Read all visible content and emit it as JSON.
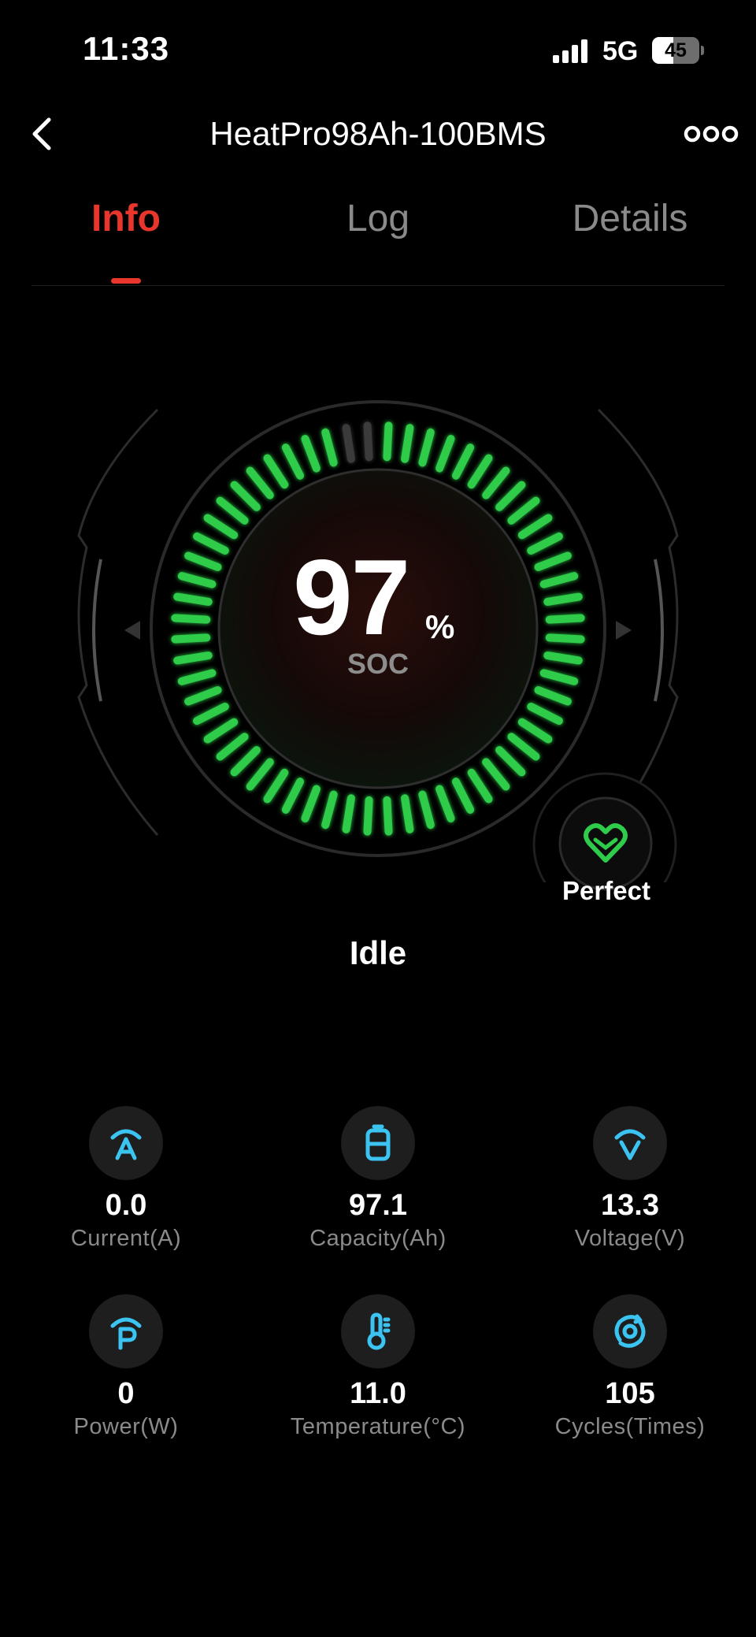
{
  "status_bar": {
    "time": "11:33",
    "network": "5G",
    "battery_percent": "45",
    "battery_level": 0.45
  },
  "nav": {
    "back_icon": "chevron-left-icon",
    "title": "HeatPro98Ah-100BMS",
    "more_icon": "more-dots-icon"
  },
  "tabs": [
    {
      "label": "Info",
      "active": true
    },
    {
      "label": "Log",
      "active": false
    },
    {
      "label": "Details",
      "active": false
    }
  ],
  "gauge": {
    "soc_value": "97",
    "soc_unit": "%",
    "soc_label": "SOC",
    "soc_fraction": 0.97,
    "active_color": "#2ecc4a",
    "inactive_color": "#3a3a3a"
  },
  "health": {
    "icon": "heart-icon",
    "label": "Perfect",
    "color": "#2ecc4a"
  },
  "state": "Idle",
  "accent_color": "#e8362c",
  "icon_color": "#3bc4f2",
  "metrics": [
    {
      "icon": "current-icon",
      "value": "0.0",
      "label": "Current(A)"
    },
    {
      "icon": "capacity-icon",
      "value": "97.1",
      "label": "Capacity(Ah)"
    },
    {
      "icon": "voltage-icon",
      "value": "13.3",
      "label": "Voltage(V)"
    },
    {
      "icon": "power-icon",
      "value": "0",
      "label": "Power(W)"
    },
    {
      "icon": "thermometer-icon",
      "value": "11.0",
      "label": "Temperature(°C)"
    },
    {
      "icon": "cycles-icon",
      "value": "105",
      "label": "Cycles(Times)"
    }
  ]
}
